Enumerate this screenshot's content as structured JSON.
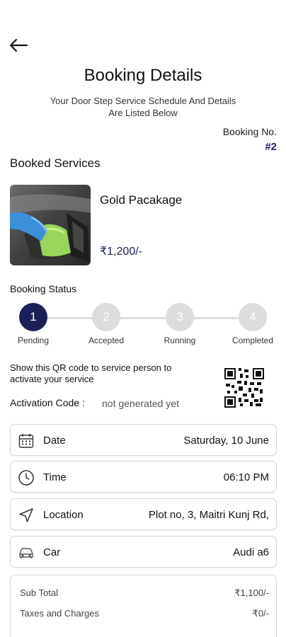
{
  "header": {
    "title": "Booking Details",
    "subtitle": "Your Door Step Service Schedule And Details Are Listed Below",
    "booking_no_label": "Booking No.",
    "booking_no_value": "#2"
  },
  "booked_services": {
    "heading": "Booked Services",
    "item": {
      "name": "Gold Pacakage",
      "price": "₹1,200/-"
    }
  },
  "status": {
    "heading": "Booking Status",
    "active_step": 1,
    "steps": [
      {
        "num": "1",
        "label": "Pending"
      },
      {
        "num": "2",
        "label": "Accepted"
      },
      {
        "num": "3",
        "label": "Running"
      },
      {
        "num": "4",
        "label": "Completed"
      }
    ]
  },
  "activation": {
    "qr_message": "Show this QR code to service person to activate your service",
    "code_label": "Activation Code :",
    "code_value": "not generated yet"
  },
  "details": [
    {
      "icon": "calendar-icon",
      "label": "Date",
      "value": "Saturday, 10 June"
    },
    {
      "icon": "clock-icon",
      "label": "Time",
      "value": "06:10 PM"
    },
    {
      "icon": "location-arrow-icon",
      "label": "Location",
      "value": "Plot no, 3, Maitri Kunj Rd,"
    },
    {
      "icon": "car-icon",
      "label": "Car",
      "value": "Audi a6"
    }
  ],
  "totals": [
    {
      "label": "Sub Total",
      "value": "₹1,100/-"
    },
    {
      "label": "Taxes and Charges",
      "value": "₹0/-"
    }
  ],
  "colors": {
    "accent": "#1c2058",
    "inactive": "#dcdcdc"
  }
}
